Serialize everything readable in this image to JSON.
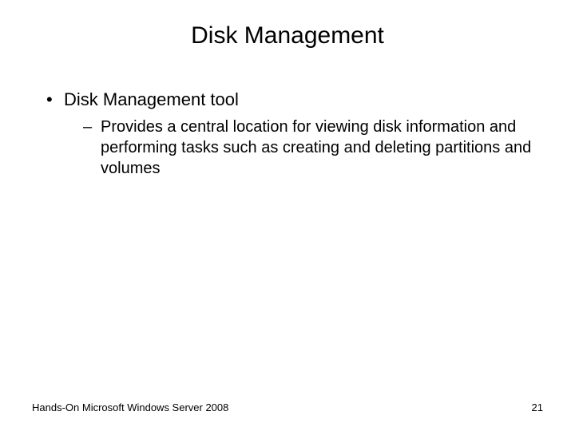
{
  "title": "Disk Management",
  "bullets": {
    "l1_0": "Disk Management tool",
    "l2_0": "Provides a central location for viewing disk information and performing tasks such as creating and deleting partitions and volumes"
  },
  "footer": {
    "left": "Hands-On Microsoft Windows Server 2008",
    "right": "21"
  }
}
